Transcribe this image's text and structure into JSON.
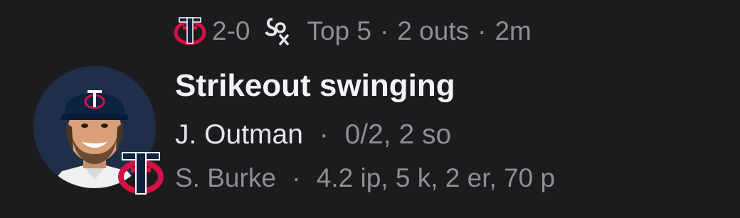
{
  "status": {
    "away_team_icon": "twins-tc-logo-icon",
    "score": "2-0",
    "home_team_icon": "white-sox-logo-icon",
    "inning": "Top 5",
    "outs": "2 outs",
    "time_ago": "2m",
    "separator": "·"
  },
  "event": {
    "title": "Strikeout swinging"
  },
  "batter": {
    "name": "J. Outman",
    "stats": "0/2, 2 so"
  },
  "pitcher": {
    "name": "S. Burke",
    "stats": "4.2 ip, 5 k, 2 er, 70 p"
  },
  "colors": {
    "background": "#1c1c1e",
    "title": "#f2f2f7",
    "muted": "#8e8e93",
    "twins_red": "#d31145",
    "twins_navy": "#0c2340"
  }
}
